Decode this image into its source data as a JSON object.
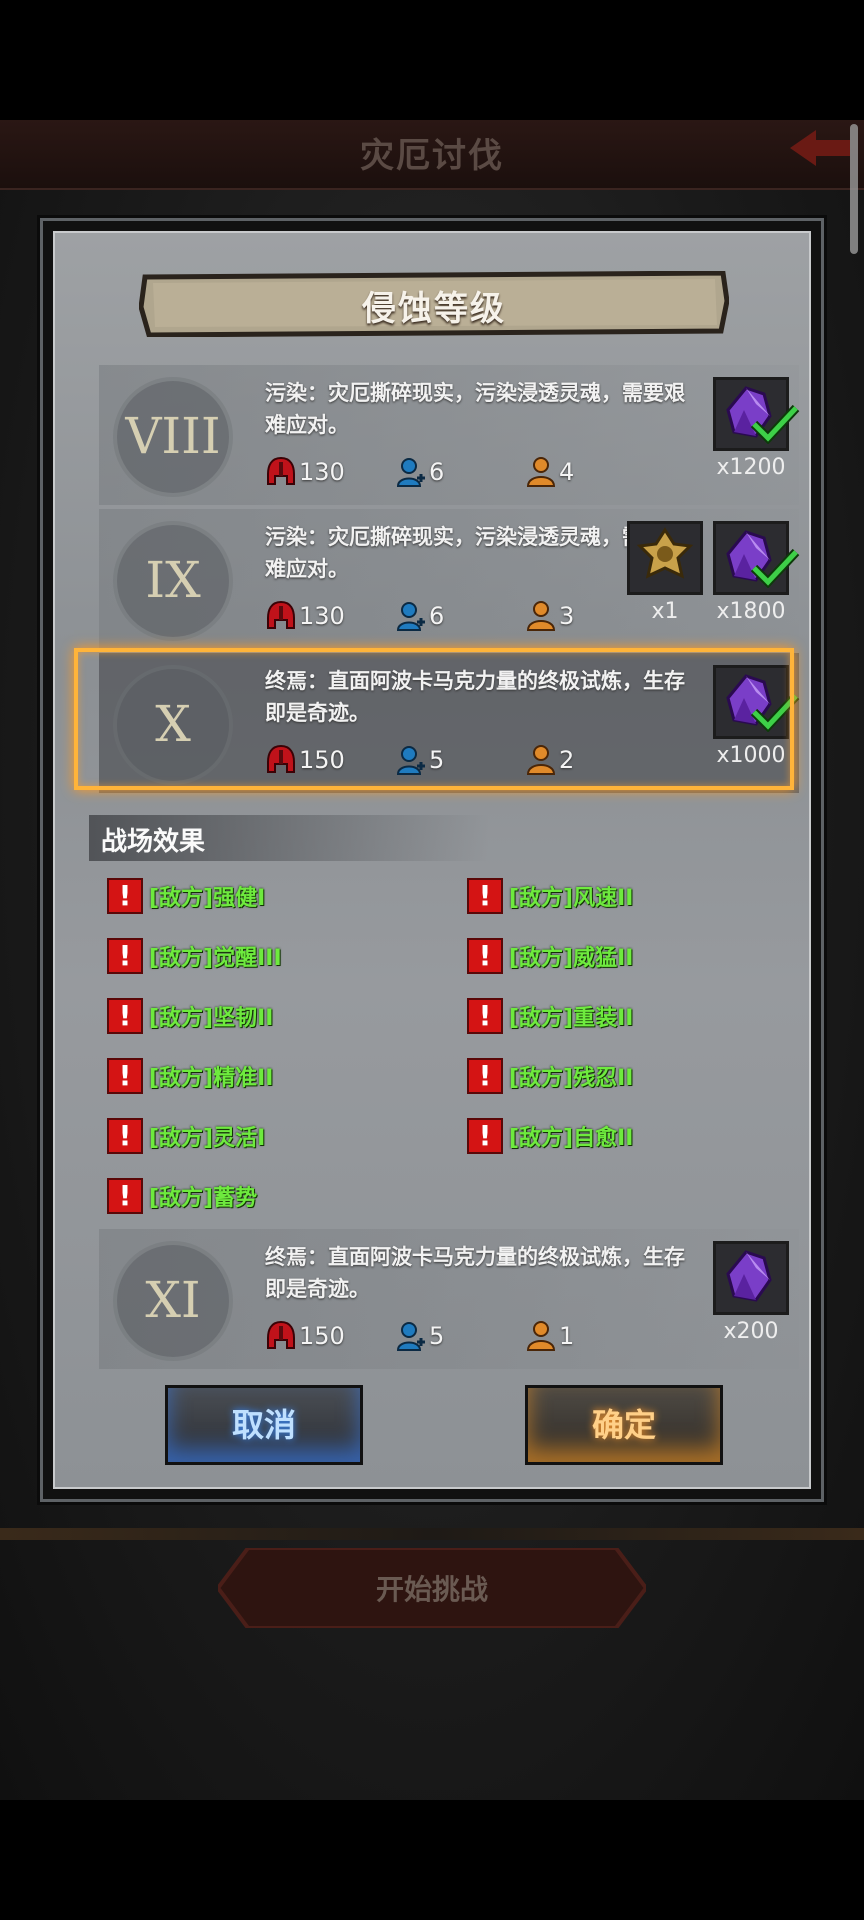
{
  "top_bar": {
    "title": "灾厄讨伐"
  },
  "bottom": {
    "start_button": "开始挑战"
  },
  "dialog": {
    "title": "侵蚀等级",
    "levels": [
      {
        "numeral": "VIII",
        "desc": "污染：灾厄撕碎现实，污染浸透灵魂，需要艰难应对。",
        "threat": "130",
        "players": "6",
        "revives": "4",
        "rewards": [
          {
            "icon": "purple-crystal-icon",
            "count": "x1200",
            "claimed": true
          }
        ]
      },
      {
        "numeral": "IX",
        "desc": "污染：灾厄撕碎现实，污染浸透灵魂，需要艰难应对。",
        "threat": "130",
        "players": "6",
        "revives": "3",
        "rewards": [
          {
            "icon": "gold-emblem-icon",
            "count": "x1",
            "claimed": false
          },
          {
            "icon": "purple-crystal-icon",
            "count": "x1800",
            "claimed": true
          }
        ]
      },
      {
        "numeral": "X",
        "desc": "终焉：直面阿波卡马克力量的终极试炼，生存即是奇迹。",
        "threat": "150",
        "players": "5",
        "revives": "2",
        "rewards": [
          {
            "icon": "purple-crystal-icon",
            "count": "x1000",
            "claimed": true
          }
        ],
        "selected": true
      },
      {
        "numeral": "XI",
        "desc": "终焉：直面阿波卡马克力量的终极试炼，生存即是奇迹。",
        "threat": "150",
        "players": "5",
        "revives": "1",
        "rewards": [
          {
            "icon": "purple-crystal-icon",
            "count": "x200",
            "claimed": false
          }
        ]
      }
    ],
    "effects_title": "战场效果",
    "effects": [
      "[敌方]强健I",
      "[敌方]风速II",
      "[敌方]觉醒III",
      "[敌方]威猛II",
      "[敌方]坚韧II",
      "[敌方]重装II",
      "[敌方]精准II",
      "[敌方]残忍II",
      "[敌方]灵活I",
      "[敌方]自愈II",
      "[敌方]蓄势"
    ],
    "cancel": "取消",
    "confirm": "确定"
  },
  "colors": {
    "effect_text": "#6eea3e",
    "warning": "#d41414",
    "selected_frame": "#ffb43a",
    "cancel_glow": "#3a8cff",
    "confirm_glow": "#ff9a2a"
  }
}
